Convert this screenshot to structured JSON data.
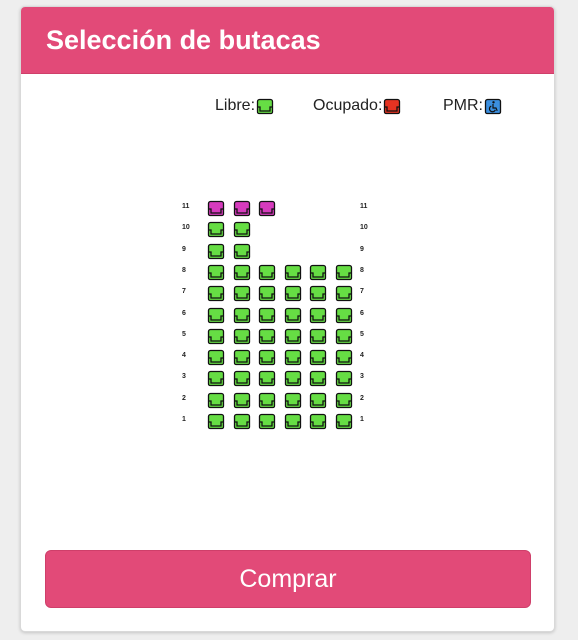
{
  "header": {
    "title": "Selección de butacas"
  },
  "legend": [
    {
      "label": "Libre:",
      "status": "libre"
    },
    {
      "label": "Ocupado:",
      "status": "ocupado"
    },
    {
      "label": "PMR:",
      "status": "pmr"
    }
  ],
  "colors": {
    "accent": "#e24a78",
    "libre": "#66dd44",
    "ocupado": "#e53322",
    "pmr": "#3b8fe0",
    "special": "#d63bbd"
  },
  "seatmap": {
    "rows": [
      {
        "number": "11",
        "seats": [
          "special",
          "special",
          "special",
          "",
          "",
          ""
        ]
      },
      {
        "number": "10",
        "seats": [
          "libre",
          "libre",
          "",
          "",
          "",
          ""
        ]
      },
      {
        "number": "9",
        "seats": [
          "libre",
          "libre",
          "",
          "",
          "",
          ""
        ]
      },
      {
        "number": "8",
        "seats": [
          "libre",
          "libre",
          "libre",
          "libre",
          "libre",
          "libre"
        ]
      },
      {
        "number": "7",
        "seats": [
          "libre",
          "libre",
          "libre",
          "libre",
          "libre",
          "libre"
        ]
      },
      {
        "number": "6",
        "seats": [
          "libre",
          "libre",
          "libre",
          "libre",
          "libre",
          "libre"
        ]
      },
      {
        "number": "5",
        "seats": [
          "libre",
          "libre",
          "libre",
          "libre",
          "libre",
          "libre"
        ]
      },
      {
        "number": "4",
        "seats": [
          "libre",
          "libre",
          "libre",
          "libre",
          "libre",
          "libre"
        ]
      },
      {
        "number": "3",
        "seats": [
          "libre",
          "libre",
          "libre",
          "libre",
          "libre",
          "libre"
        ]
      },
      {
        "number": "2",
        "seats": [
          "libre",
          "libre",
          "libre",
          "libre",
          "libre",
          "libre"
        ]
      },
      {
        "number": "1",
        "seats": [
          "libre",
          "libre",
          "libre",
          "libre",
          "libre",
          "libre"
        ]
      }
    ]
  },
  "actions": {
    "buy_label": "Comprar"
  }
}
